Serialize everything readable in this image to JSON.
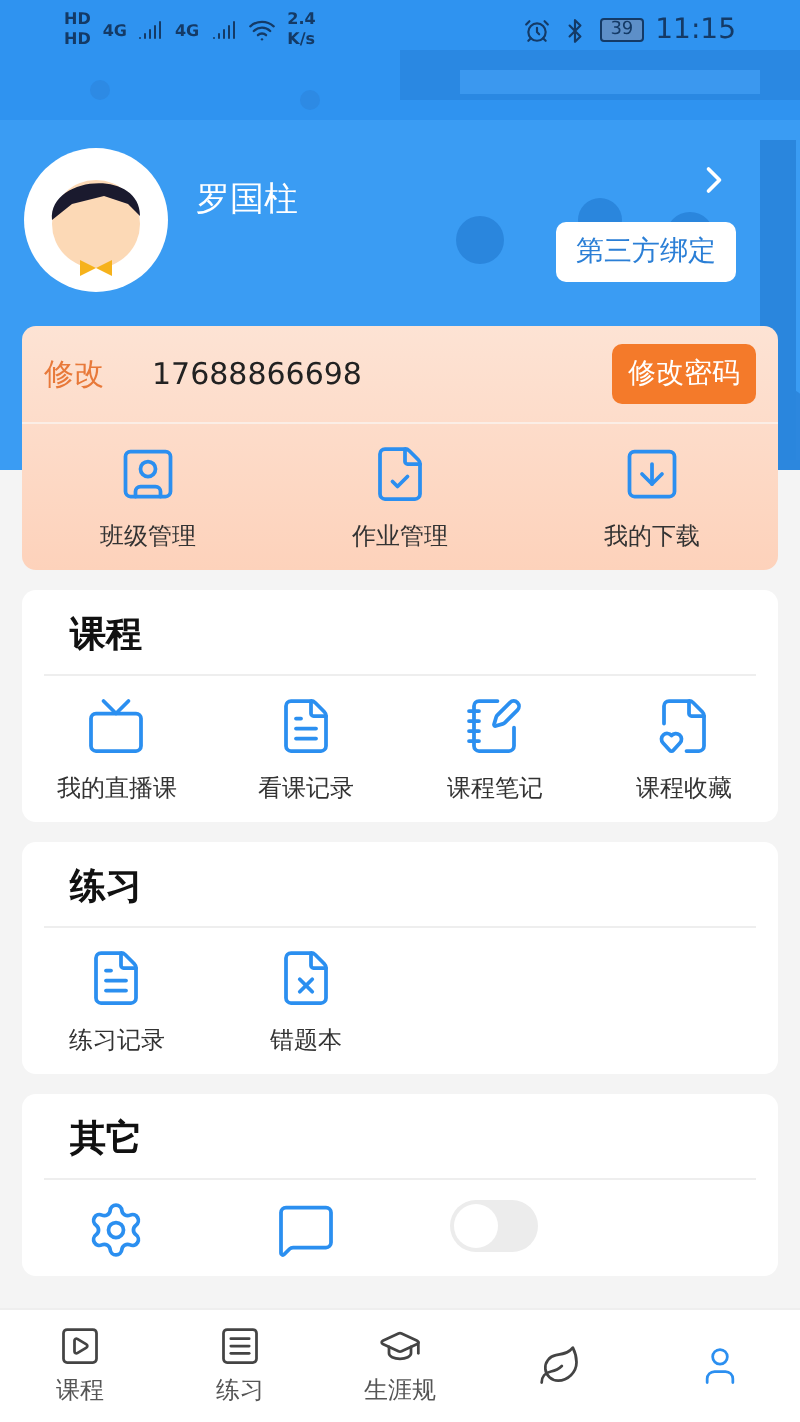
{
  "status_bar": {
    "network_tags": [
      "HD",
      "HD"
    ],
    "signal_tags": [
      "4G",
      "4G"
    ],
    "speed": [
      "2.4",
      "K/s"
    ],
    "battery": "39",
    "time": "11:15"
  },
  "profile": {
    "name": "罗国柱",
    "bind_button": "第三方绑定"
  },
  "account": {
    "edit_label": "修改",
    "phone": "17688866698",
    "password_button": "修改密码",
    "actions": [
      "班级管理",
      "作业管理",
      "我的下载"
    ]
  },
  "sections": [
    {
      "title": "课程",
      "items": [
        "我的直播课",
        "看课记录",
        "课程笔记",
        "课程收藏"
      ]
    },
    {
      "title": "练习",
      "items": [
        "练习记录",
        "错题本"
      ]
    },
    {
      "title": "其它",
      "items": [
        {
          "kind": "icon"
        },
        {
          "kind": "icon"
        },
        {
          "kind": "switch",
          "on": false
        }
      ]
    }
  ],
  "tab_bar": [
    {
      "label": "课程",
      "selected": false
    },
    {
      "label": "练习",
      "selected": false
    },
    {
      "label": "生涯规",
      "selected": false
    },
    {
      "selected": false
    },
    {
      "selected": true
    }
  ]
}
